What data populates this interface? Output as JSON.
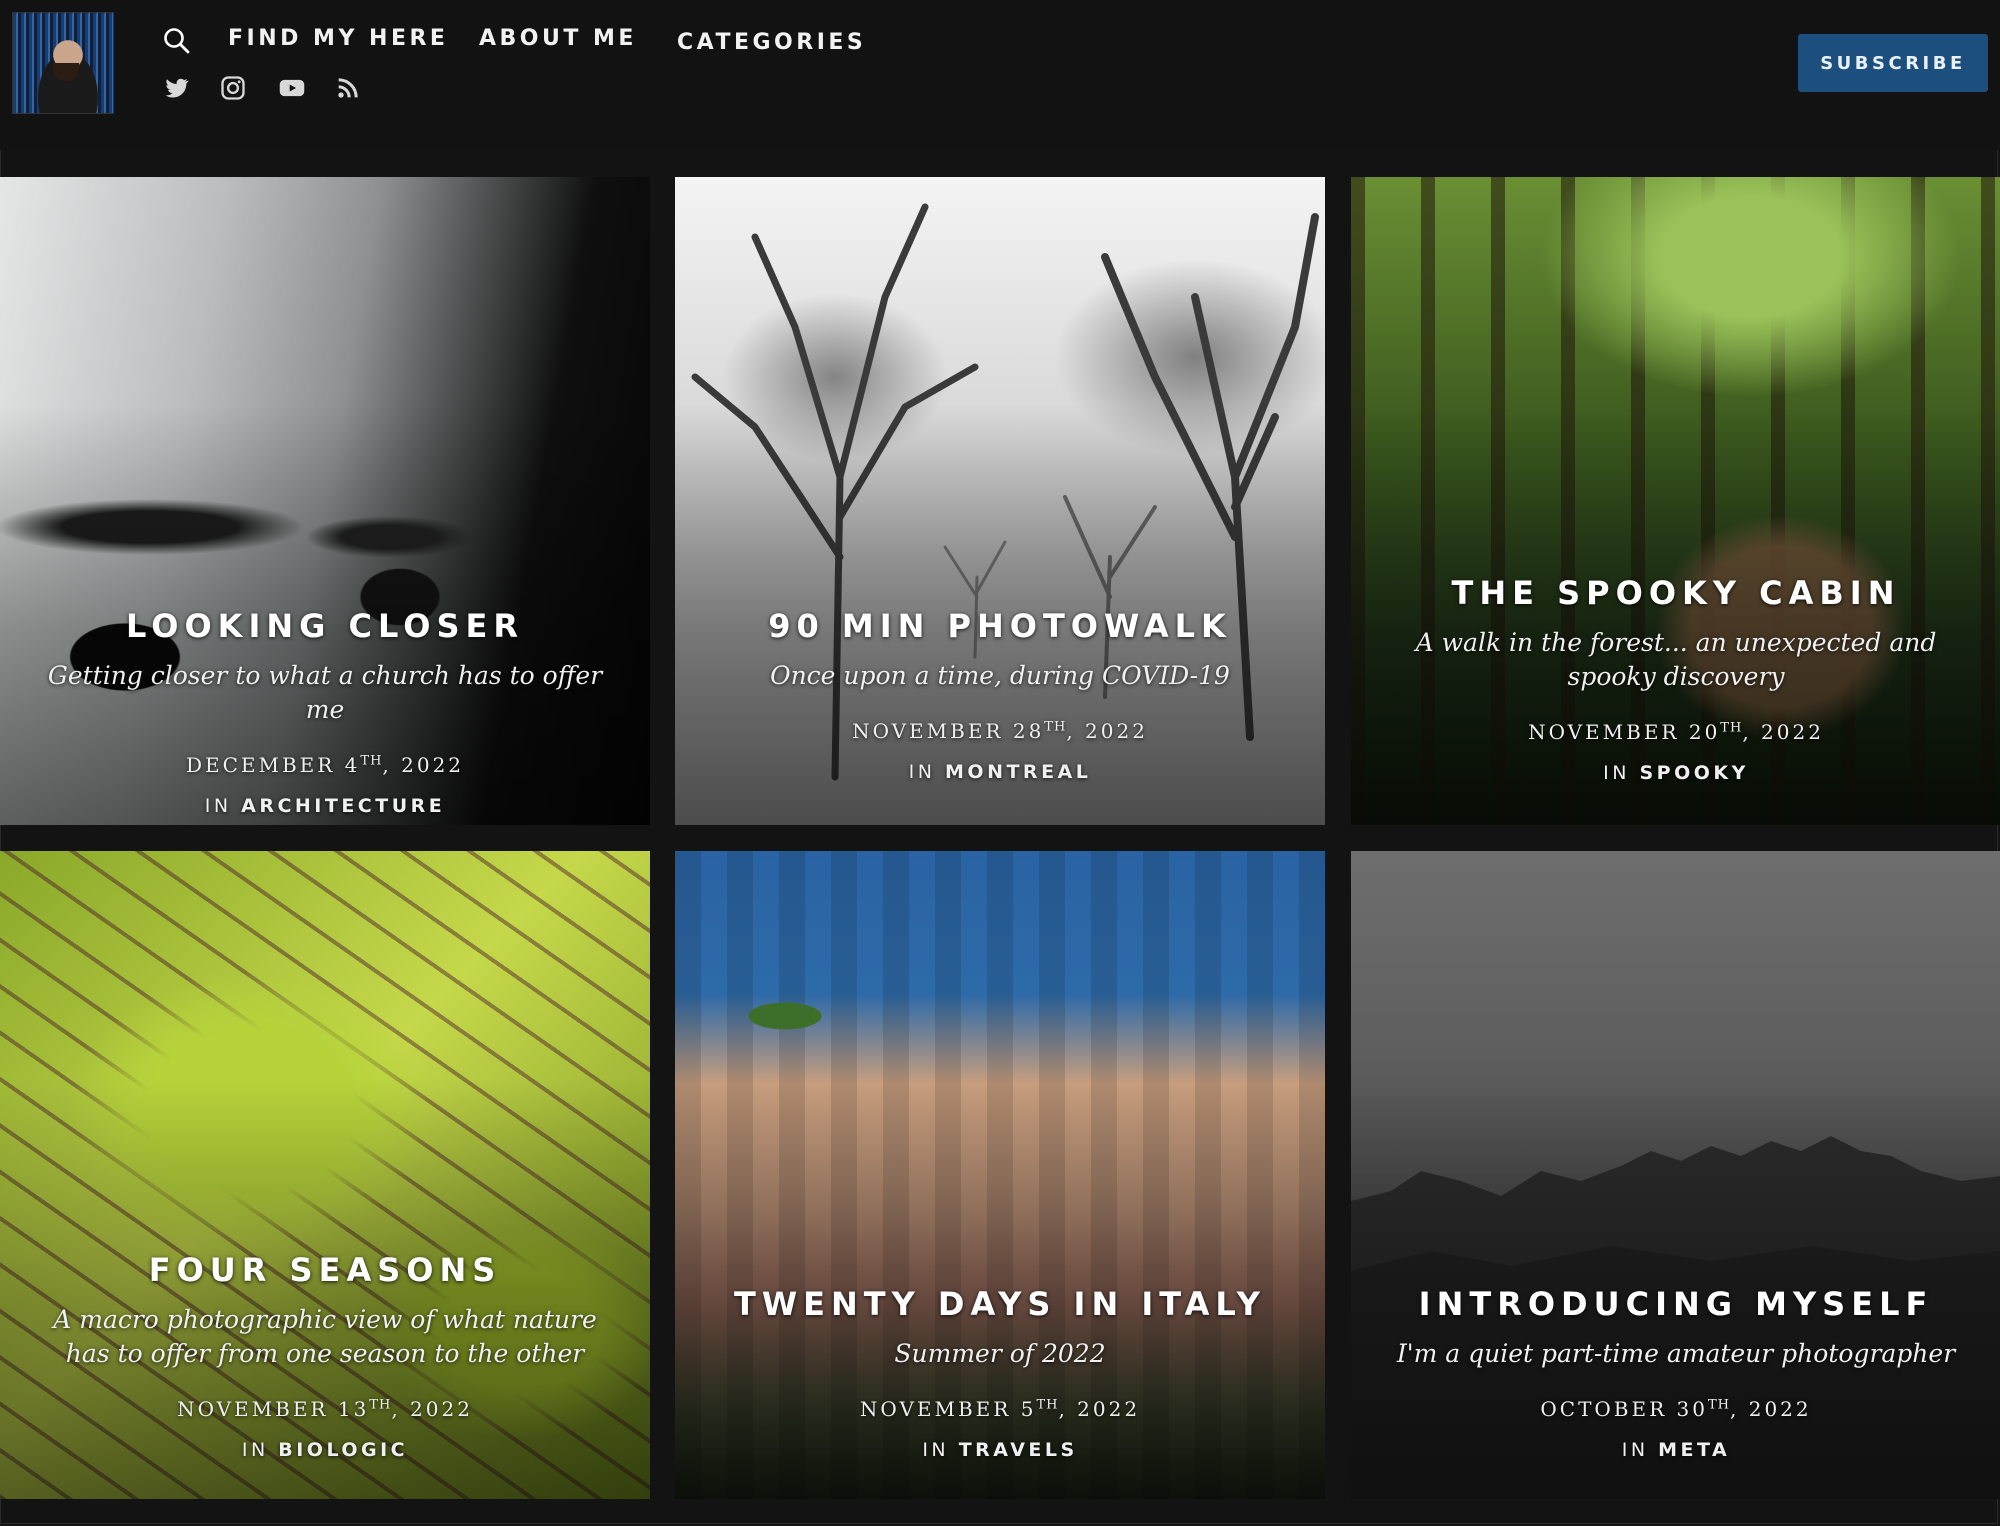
{
  "header": {
    "nav": [
      "FIND MY HERE",
      "ABOUT ME",
      "CATEGORIES"
    ],
    "subscribe_label": "SUBSCRIBE",
    "social_icons": [
      "twitter-icon",
      "instagram-icon",
      "youtube-icon",
      "rss-icon"
    ]
  },
  "posts": [
    {
      "title": "LOOKING CLOSER",
      "subtitle": "Getting closer to what a church has to offer me",
      "date_prefix": "DECEMBER 4",
      "date_suffix": "TH",
      "date_year": ", 2022",
      "in_label": "IN",
      "category": "ARCHITECTURE"
    },
    {
      "title": "90 MIN PHOTOWALK",
      "subtitle": "Once upon a time, during COVID-19",
      "date_prefix": "NOVEMBER 28",
      "date_suffix": "TH",
      "date_year": ", 2022",
      "in_label": "IN",
      "category": "MONTREAL"
    },
    {
      "title": "THE SPOOKY CABIN",
      "subtitle": "A walk in the forest... an unexpected and spooky discovery",
      "date_prefix": "NOVEMBER 20",
      "date_suffix": "TH",
      "date_year": ", 2022",
      "in_label": "IN",
      "category": "SPOOKY"
    },
    {
      "title": "FOUR SEASONS",
      "subtitle": "A macro photographic view of what nature has to offer from one season to the other",
      "date_prefix": "NOVEMBER 13",
      "date_suffix": "TH",
      "date_year": ", 2022",
      "in_label": "IN",
      "category": "BIOLOGIC"
    },
    {
      "title": "TWENTY DAYS IN ITALY",
      "subtitle": "Summer of 2022",
      "date_prefix": "NOVEMBER 5",
      "date_suffix": "TH",
      "date_year": ", 2022",
      "in_label": "IN",
      "category": "TRAVELS"
    },
    {
      "title": "INTRODUCING MYSELF",
      "subtitle": "I'm a quiet part-time amateur photographer",
      "date_prefix": "OCTOBER 30",
      "date_suffix": "TH",
      "date_year": ", 2022",
      "in_label": "IN",
      "category": "META"
    }
  ],
  "colors": {
    "background": "#131314",
    "subscribe_button": "#1c4f7e"
  }
}
